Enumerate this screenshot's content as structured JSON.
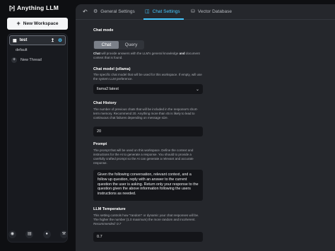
{
  "app": {
    "name": "Anything LLM",
    "logo_glyph": "[>]"
  },
  "sidebar": {
    "new_workspace_label": "New Workspace",
    "workspace": {
      "name": "test",
      "thread_default": "default",
      "new_thread_label": "New Thread"
    },
    "footer_icons": [
      "github-icon",
      "book-icon",
      "discord-icon",
      "wrench-icon"
    ]
  },
  "tabs": [
    {
      "label": "General Settings",
      "icon": "gear-icon"
    },
    {
      "label": "Chat Settings",
      "icon": "chat-bubble-icon",
      "active": true
    },
    {
      "label": "Vector Database",
      "icon": "database-icon"
    }
  ],
  "chat_mode": {
    "title": "Chat mode",
    "options": [
      "Chat",
      "Query"
    ],
    "selected": "Chat",
    "desc_emphasis": "Chat",
    "desc_rest": " will provide answers with the LLM's general knowledge ",
    "desc_emphasis2": "and",
    "desc_rest2": " document context that is found."
  },
  "chat_model": {
    "title": "Chat model (ollama)",
    "description": "The specific chat model that will be used for this workspace. If empty, will use the system LLM preference.",
    "value": "llama2:latest"
  },
  "chat_history": {
    "title": "Chat History",
    "description": "The number of previous chats that will be included in the response's short-term memory. Recommend 20. Anything more than 45 is likely to lead to continuous chat failures depending on message size.",
    "value": "20"
  },
  "prompt": {
    "title": "Prompt",
    "description": "The prompt that will be used on this workspace. Define the context and instructions for the AI to generate a response. You should to provide a carefully crafted prompt so the AI can generate a relevant and accurate response.",
    "value": "Given the following conversation, relevant context, and a follow up question, reply with an answer to the current question the user is asking. Return only your response to the question given the above information following the users instructions as needed."
  },
  "llm_temperature": {
    "title": "LLM Temperature",
    "description_1": "This setting controls how \"random\" or dynamic your chat responses will be.",
    "description_2": "The higher the number (1.0 maximum) the more random and incoherent.",
    "recommended": "Recommended: 0.7",
    "value": "0.7"
  },
  "colors": {
    "accent": "#46c8ff",
    "panel": "#25272c",
    "input_bg": "#141519"
  }
}
